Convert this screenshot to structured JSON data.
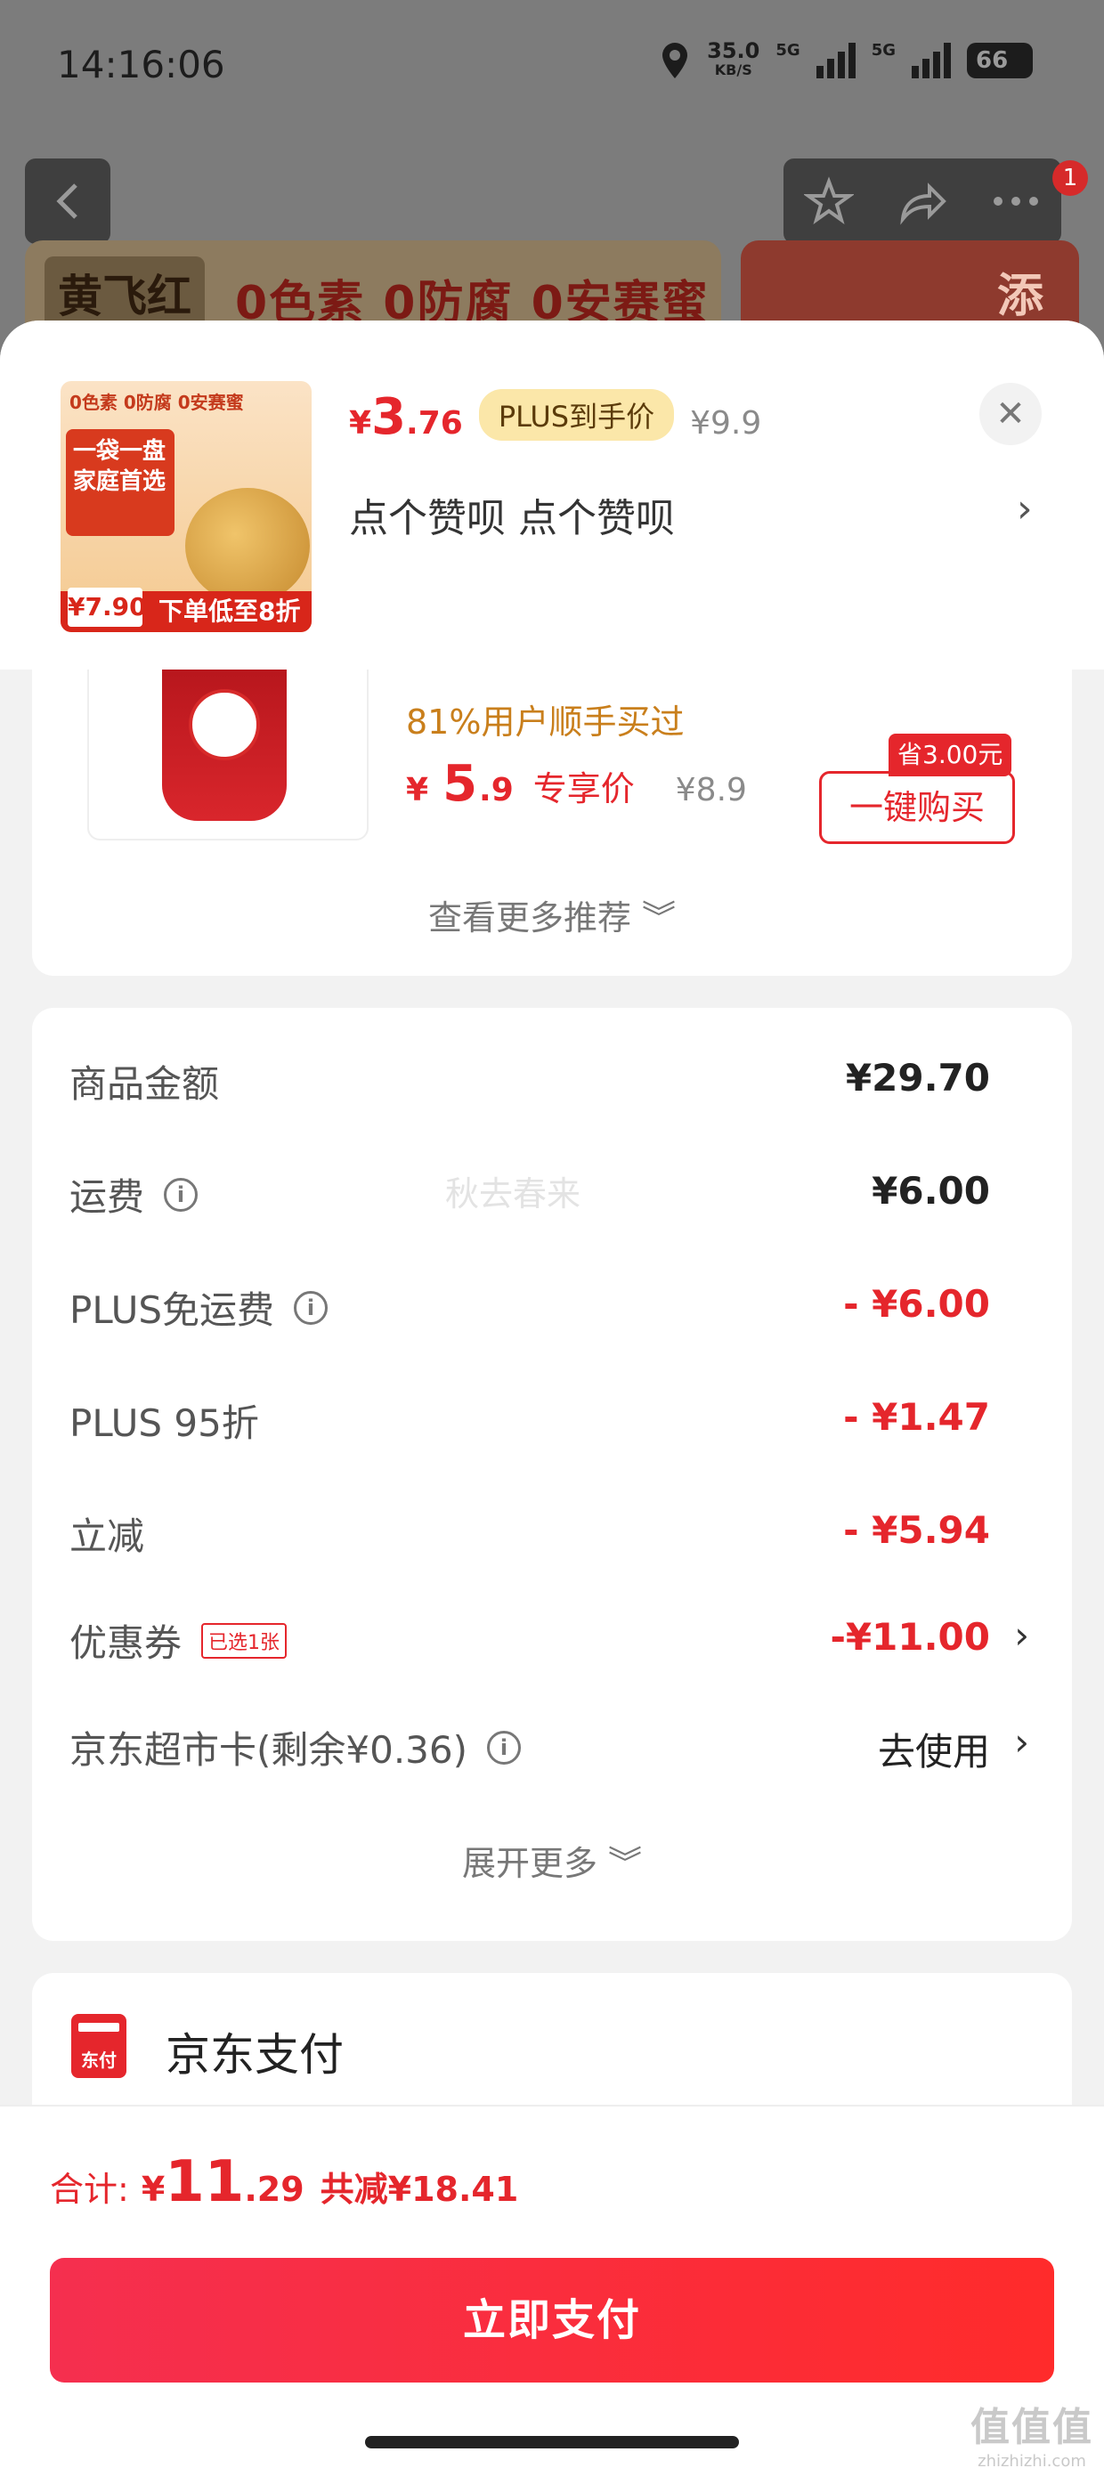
{
  "status_bar": {
    "time": "14:16:06",
    "net_speed": "35.0",
    "net_unit": "KB/S",
    "signal1": "5G",
    "signal2": "5G",
    "battery": "66"
  },
  "background": {
    "banner_logo": "黄飞红",
    "banner_text": "0色素 0防腐 0安赛蜜",
    "banner2_text": "添",
    "cart_badge": "1"
  },
  "product": {
    "thumb": {
      "top_text": "0色素 0防腐 0安赛蜜",
      "red_box": "一袋一盘 家庭首选",
      "bottom_text": "下单低至8折",
      "price_tag": "¥7.90"
    },
    "price_symbol": "¥",
    "price_int": "3",
    "price_dec": ".76",
    "plus_tag": "PLUS到手价",
    "original_price": "¥9.9",
    "name": "点个赞呗  点个赞呗",
    "close_glyph": "✕",
    "chevron": "›"
  },
  "recommend": {
    "users_text": "81%用户顺手买过",
    "price_symbol": "¥",
    "price_int": "5",
    "price_dec": ".9",
    "exclusive": "专享价",
    "original": "¥8.9",
    "save_tag": "省3.00元",
    "buy_button": "一键购买",
    "more": "查看更多推荐 ︾"
  },
  "totals": {
    "watermark": "秋去春来",
    "rows": [
      {
        "label": "商品金额",
        "value": "¥29.70"
      },
      {
        "label": "运费",
        "value": "¥6.00"
      },
      {
        "label": "PLUS免运费",
        "value": "- ¥6.00"
      },
      {
        "label": "PLUS 95折",
        "value": "- ¥1.47"
      },
      {
        "label": "立减",
        "value": "- ¥5.94"
      },
      {
        "label": "优惠券",
        "tag": "已选1张",
        "value": "-¥11.00"
      },
      {
        "label": "京东超市卡(剩余¥0.36)",
        "value": "去使用"
      }
    ],
    "expand": "展开更多 ︾",
    "info_glyph": "i",
    "chevron": "›"
  },
  "payment": {
    "icon_text": "东付",
    "label": "京东支付"
  },
  "footer": {
    "total_label": "合计:",
    "total_symbol": "¥",
    "total_int": "11",
    "total_dec": ".29",
    "saved": "共减¥18.41",
    "pay_button": "立即支付",
    "corner_mark": "值值值",
    "corner_domain": "zhizhizhi.com"
  },
  "colors": {
    "accent_red": "#e5262c",
    "plus_gold": "#fbe7a9",
    "users_orange": "#c97f1c"
  }
}
